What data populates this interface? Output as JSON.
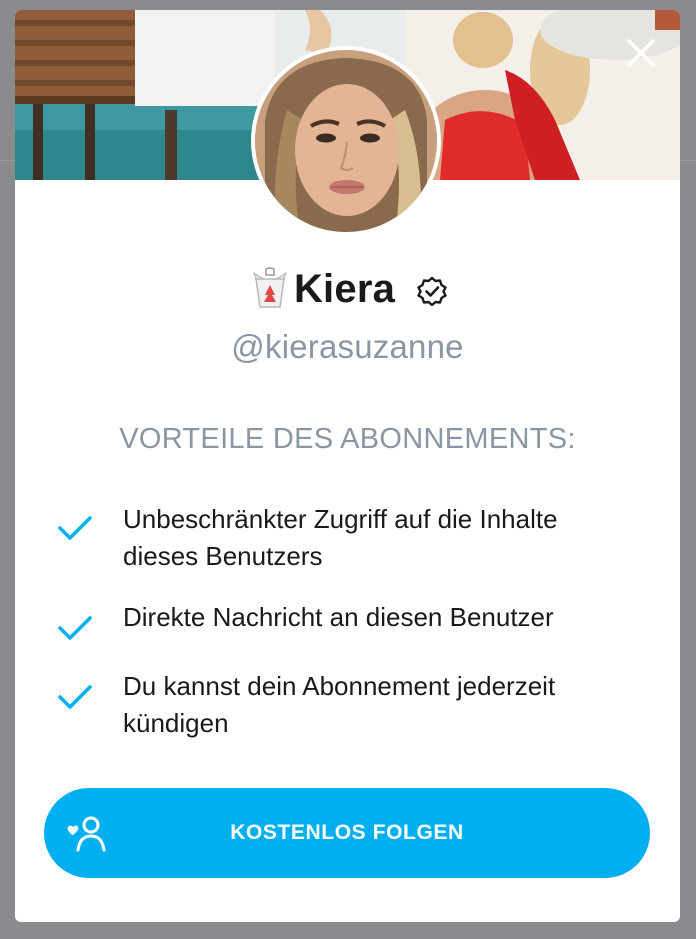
{
  "icons": {
    "close": "close-icon",
    "verified": "verified-badge-icon",
    "name_emoji": "takeout-box-emoji",
    "check": "check-icon",
    "follow": "follow-user-icon"
  },
  "colors": {
    "accent": "#00aff0",
    "muted_text": "#8a96a3",
    "primary_text": "#1a1a1a",
    "overlay": "#8a8b8e"
  },
  "profile": {
    "display_name": "Kiera",
    "username": "@kierasuzanne"
  },
  "benefits": {
    "title": "VORTEILE DES ABONNEMENTS:",
    "items": [
      {
        "line1": "Unbeschränkter Zugriff auf die Inhalte",
        "line2": "dieses Benutzers"
      },
      {
        "line1": "Direkte Nachricht an diesen Benutzer",
        "line2": ""
      },
      {
        "line1": "Du kannst dein Abonnement jederzeit",
        "line2": "kündigen"
      }
    ]
  },
  "cta": {
    "label": "KOSTENLOS FOLGEN"
  }
}
